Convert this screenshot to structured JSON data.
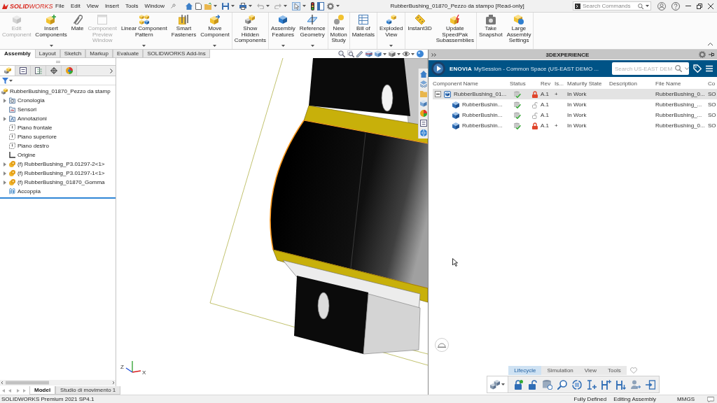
{
  "title_bar": {
    "logo": "**SOLID**WORKS",
    "menus": [
      "File",
      "Edit",
      "View",
      "Insert",
      "Tools",
      "Window"
    ],
    "document_title": "RubberBushing_01870_Pezzo da stampo [Read-only]",
    "search": {
      "placeholder": "Search Commands"
    }
  },
  "command_manager": {
    "groups": [
      {
        "buttons": [
          {
            "label": "Edit\nComponent",
            "disabled": true,
            "dropdown": false
          },
          {
            "label": "Insert\nComponents",
            "disabled": false,
            "dropdown": true
          },
          {
            "label": "Mate",
            "disabled": false,
            "dropdown": false
          },
          {
            "label": "Component\nPreview\nWindow",
            "disabled": true,
            "dropdown": false
          },
          {
            "label": "Linear Component\nPattern",
            "disabled": false,
            "dropdown": true
          },
          {
            "label": "Smart\nFasteners",
            "disabled": false,
            "dropdown": false
          },
          {
            "label": "Move\nComponent",
            "disabled": false,
            "dropdown": true
          }
        ]
      },
      {
        "buttons": [
          {
            "label": "Show\nHidden\nComponents",
            "disabled": false,
            "dropdown": false
          }
        ]
      },
      {
        "buttons": [
          {
            "label": "Assembly\nFeatures",
            "disabled": false,
            "dropdown": true
          },
          {
            "label": "Reference\nGeometry",
            "disabled": false,
            "dropdown": true
          }
        ]
      },
      {
        "buttons": [
          {
            "label": "New\nMotion\nStudy",
            "disabled": false,
            "dropdown": false
          }
        ]
      },
      {
        "buttons": [
          {
            "label": "Bill of\nMaterials",
            "disabled": false,
            "dropdown": false
          }
        ]
      },
      {
        "buttons": [
          {
            "label": "Exploded\nView",
            "disabled": false,
            "dropdown": true
          }
        ]
      },
      {
        "buttons": [
          {
            "label": "Instant3D",
            "disabled": false,
            "dropdown": false
          },
          {
            "label": "Update\nSpeedPak\nSubassemblies",
            "disabled": false,
            "dropdown": false
          }
        ]
      },
      {
        "buttons": [
          {
            "label": "Take\nSnapshot",
            "disabled": false,
            "dropdown": false
          },
          {
            "label": "Large\nAssembly\nSettings",
            "disabled": false,
            "dropdown": false
          }
        ]
      }
    ],
    "tabs": [
      {
        "label": "Assembly",
        "selected": true
      },
      {
        "label": "Layout",
        "selected": false
      },
      {
        "label": "Sketch",
        "selected": false
      },
      {
        "label": "Markup",
        "selected": false
      },
      {
        "label": "Evaluate",
        "selected": false
      },
      {
        "label": "SOLIDWORKS Add-Ins",
        "selected": false
      }
    ]
  },
  "feature_manager": {
    "panel_tabs": [
      {
        "selected": true
      },
      {
        "selected": false
      },
      {
        "selected": false
      },
      {
        "selected": false
      },
      {
        "selected": false
      }
    ],
    "root": {
      "label": "RubberBushing_01870_Pezzo da stamp",
      "kind": "assembly",
      "children": [
        {
          "label": "Cronologia",
          "kind": "history",
          "expandable": true
        },
        {
          "label": "Sensori",
          "kind": "sensors",
          "expandable": false
        },
        {
          "label": "Annotazioni",
          "kind": "annotations",
          "expandable": true
        },
        {
          "label": "Piano frontale",
          "kind": "plane",
          "expandable": false
        },
        {
          "label": "Piano superiore",
          "kind": "plane",
          "expandable": false
        },
        {
          "label": "Piano destro",
          "kind": "plane",
          "expandable": false
        },
        {
          "label": "Origine",
          "kind": "origin",
          "expandable": false
        },
        {
          "label": "(f) RubberBushing_P3.01297-2<1>",
          "kind": "part",
          "expandable": true
        },
        {
          "label": "(f) RubberBushing_P3.01297-1<1>",
          "kind": "part",
          "expandable": true
        },
        {
          "label": "(f) RubberBushing_01870_Gomma",
          "kind": "part",
          "expandable": true
        },
        {
          "label": "Accoppia",
          "kind": "mates",
          "expandable": false
        }
      ]
    }
  },
  "view_triad": {
    "labels": [
      "Z",
      "X"
    ]
  },
  "model_tabs": [
    {
      "label": "Model",
      "selected": true
    },
    {
      "label": "Studio di movimento 1",
      "selected": false
    }
  ],
  "experience_panel": {
    "title": "3DEXPERIENCE",
    "app": "ENOVIA",
    "session": "MySession - Common Space (US-EAST DEMO ...",
    "search": {
      "placeholder": "Search US-EAST DEM"
    },
    "table": {
      "columns": [
        "Component Name",
        "Status",
        "Rev",
        "Is...",
        "Maturity State",
        "Description",
        "File Name",
        "Co"
      ],
      "rows": [
        {
          "name": "RubberBushing_01...",
          "kind": "assembly",
          "selected": true,
          "expanded": true,
          "locked": true,
          "rev": "A.1",
          "is": "+",
          "maturity": "In Work",
          "file_name": "RubberBushing_0...",
          "co": "SO",
          "children": [
            {
              "name": "RubberBushin...",
              "kind": "part",
              "selected": false,
              "locked": false,
              "rev": "A.1",
              "maturity": "In Work",
              "file_name": "RubberBushing_...",
              "co": "SO"
            },
            {
              "name": "RubberBushin...",
              "kind": "part",
              "selected": false,
              "locked": false,
              "rev": "A.1",
              "maturity": "In Work",
              "file_name": "RubberBushing_...",
              "co": "SO"
            },
            {
              "name": "RubberBushin...",
              "kind": "part",
              "selected": false,
              "locked": true,
              "rev": "A.1",
              "is": "+",
              "maturity": "In Work",
              "file_name": "RubberBushing_0...",
              "co": "SO"
            }
          ]
        }
      ]
    },
    "tabs": [
      {
        "label": "Lifecycle",
        "selected": true
      },
      {
        "label": "Simulation",
        "selected": false
      },
      {
        "label": "View",
        "selected": false
      },
      {
        "label": "Tools",
        "selected": false
      }
    ]
  },
  "status_bar": {
    "product": "SOLIDWORKS Premium 2021 SP4.1",
    "definition": "Fully Defined",
    "mode": "Editing Assembly",
    "units": "MMGS"
  }
}
